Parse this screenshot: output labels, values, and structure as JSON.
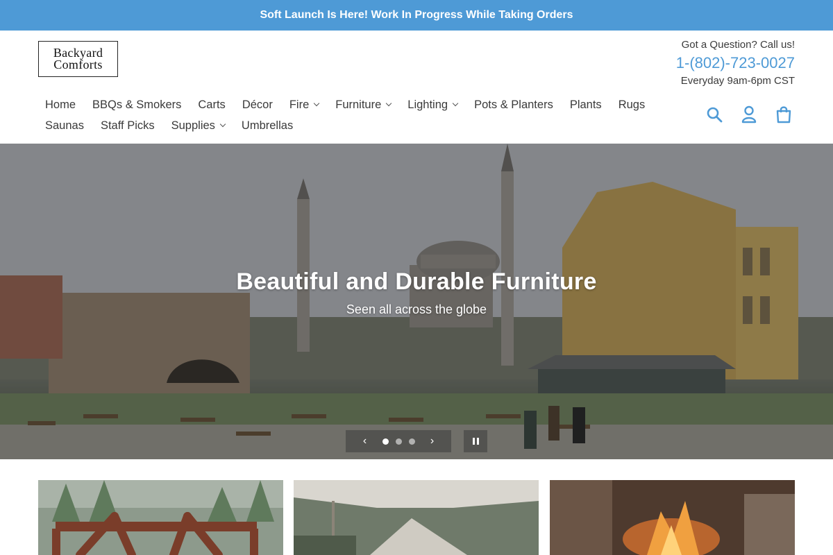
{
  "announcement": {
    "text": "Soft Launch Is Here! Work In Progress While Taking Orders"
  },
  "logo": {
    "line1": "Backyard",
    "line2": "Comforts"
  },
  "contact": {
    "question": "Got a Question? Call us!",
    "phone": "1-(802)-723-0027",
    "hours": "Everyday 9am-6pm CST"
  },
  "nav": {
    "row1": [
      {
        "label": "Home",
        "dropdown": false
      },
      {
        "label": "BBQs & Smokers",
        "dropdown": false
      },
      {
        "label": "Carts",
        "dropdown": false
      },
      {
        "label": "Décor",
        "dropdown": false
      },
      {
        "label": "Fire",
        "dropdown": true
      },
      {
        "label": "Furniture",
        "dropdown": true
      },
      {
        "label": "Lighting",
        "dropdown": true
      },
      {
        "label": "Pots & Planters",
        "dropdown": false
      },
      {
        "label": "Plants",
        "dropdown": false
      },
      {
        "label": "Rugs",
        "dropdown": false
      }
    ],
    "row2": [
      {
        "label": "Saunas",
        "dropdown": false
      },
      {
        "label": "Staff Picks",
        "dropdown": false
      },
      {
        "label": "Supplies",
        "dropdown": true
      },
      {
        "label": "Umbrellas",
        "dropdown": false
      }
    ]
  },
  "header_icons": [
    "search-icon",
    "account-icon",
    "cart-icon"
  ],
  "hero": {
    "title": "Beautiful and Durable Furniture",
    "subtitle": "Seen all across the globe",
    "slide_count": 3,
    "active_slide": 1
  },
  "colors": {
    "accent": "#4e9ad6",
    "text": "#3a3a3a"
  }
}
